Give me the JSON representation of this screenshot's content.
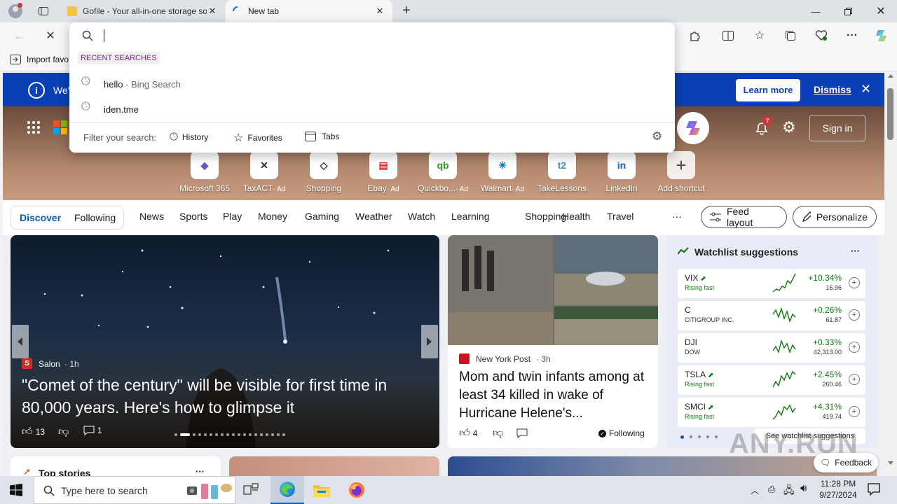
{
  "browser": {
    "tabs": [
      {
        "title": "Gofile - Your all-in-one storage so"
      },
      {
        "title": "New tab"
      }
    ],
    "favorites_bar": {
      "import_label": "Import favo"
    }
  },
  "omnibox": {
    "recent_header": "RECENT SEARCHES",
    "suggestions": [
      {
        "text": "hello",
        "suffix": " - Bing Search"
      },
      {
        "text": "iden.tme",
        "suffix": ""
      }
    ],
    "filter_label": "Filter your search:",
    "filters": [
      "History",
      "Favorites",
      "Tabs"
    ]
  },
  "banner": {
    "text": "We'",
    "learn_more": "Learn more",
    "dismiss": "Dismiss"
  },
  "header": {
    "notification_count": "7",
    "sign_in": "Sign in"
  },
  "shortcuts": [
    {
      "label": "Microsoft 365",
      "ad": "",
      "icon": "microsoft365-icon",
      "color": "#5b5fc7"
    },
    {
      "label": "TaxACT",
      "ad": "· Ad",
      "icon": "taxact-icon",
      "color": "#1b2b4a"
    },
    {
      "label": "Shopping",
      "ad": "",
      "icon": "shopping-tag-icon",
      "color": "#333333"
    },
    {
      "label": "Ebay",
      "ad": "· Ad",
      "icon": "ebay-icon",
      "color": "#e53238"
    },
    {
      "label": "Quickbo...",
      "ad": "· Ad",
      "icon": "quickbooks-icon",
      "color": "#2ca01c"
    },
    {
      "label": "Walmart",
      "ad": "· Ad",
      "icon": "walmart-icon",
      "color": "#0071ce"
    },
    {
      "label": "TakeLessons",
      "ad": "",
      "icon": "takelessons-icon",
      "color": "#4a90c2"
    },
    {
      "label": "LinkedIn",
      "ad": "",
      "icon": "linkedin-icon",
      "color": "#0a66c2"
    },
    {
      "label": "Add shortcut",
      "ad": "",
      "icon": "plus-icon",
      "color": "#444444"
    }
  ],
  "nav": {
    "discover": "Discover",
    "following": "Following",
    "items": [
      "News",
      "Sports",
      "Play",
      "Money",
      "Gaming",
      "Weather",
      "Watch",
      "Learning",
      "Shopping",
      "Health",
      "Travel"
    ],
    "more": "···",
    "feed_layout": "Feed layout",
    "personalize": "Personalize"
  },
  "main_story": {
    "source": "Salon",
    "time": "· 1h",
    "headline": "\"Comet of the century\" will be visible for first time in 80,000 years. Here's how to glimpse it",
    "likes": "13",
    "comments": "1"
  },
  "side_story": {
    "source": "New York Post",
    "time": "· 3h",
    "headline": "Mom and twin infants among at least 34 killed in wake of Hurricane Helene's...",
    "likes": "4",
    "following": "Following"
  },
  "watchlist": {
    "title": "Watchlist suggestions",
    "more": "···",
    "see_all": "See watchlist suggestions",
    "items": [
      {
        "symbol": "VIX",
        "sub": "Rising fast",
        "change": "+10.34%",
        "value": "16.96",
        "rising": true
      },
      {
        "symbol": "C",
        "sub": "CITIGROUP INC.",
        "change": "+0.26%",
        "value": "61.87",
        "rising": false
      },
      {
        "symbol": "DJI",
        "sub": "DOW",
        "change": "+0.33%",
        "value": "42,313.00",
        "rising": false
      },
      {
        "symbol": "TSLA",
        "sub": "Rising fast",
        "change": "+2.45%",
        "value": "260.46",
        "rising": true
      },
      {
        "symbol": "SMCI",
        "sub": "Rising fast",
        "change": "+4.31%",
        "value": "419.74",
        "rising": true
      }
    ]
  },
  "bottom_cards": {
    "top_stories": "Top stories",
    "feedback": "Feedback"
  },
  "taskbar": {
    "search_placeholder": "Type here to search",
    "time": "11:28 PM",
    "date": "9/27/2024"
  },
  "watermark": "ANY.RUN",
  "colors": {
    "accent": "#0a3fb5",
    "positive": "#0e7a0d",
    "rising_text": "#107c10"
  }
}
